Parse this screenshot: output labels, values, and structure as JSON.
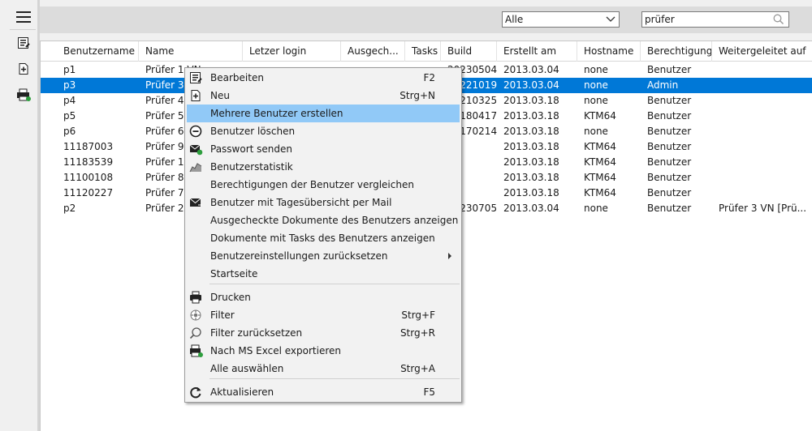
{
  "toolbar": {
    "icons": [
      "hamburger-menu-icon",
      "edit-list-icon",
      "new-document-icon",
      "export-printer-icon"
    ]
  },
  "filter": {
    "scope_value": "Alle",
    "search_value": "prüfer"
  },
  "grid": {
    "columns": [
      "Benutzername",
      "Name",
      "Letzer login",
      "Ausgech...",
      "Tasks",
      "Build",
      "Erstellt am",
      "Hostname",
      "Berechtigung",
      "Weitergeleitet auf"
    ],
    "rows": [
      {
        "user": "p1",
        "name": "Prüfer 1 VN",
        "login": "",
        "out": "",
        "tasks": "",
        "build": "20230504",
        "created": "2013.03.04",
        "host": "none",
        "perm": "Benutzer",
        "fwd": "",
        "selected": false
      },
      {
        "user": "p3",
        "name": "Prüfer 3",
        "login": "",
        "out": "",
        "tasks": "",
        "build": "20221019",
        "created": "2013.03.04",
        "host": "none",
        "perm": "Admin",
        "fwd": "",
        "selected": true
      },
      {
        "user": "p4",
        "name": "Prüfer 4",
        "login": "",
        "out": "",
        "tasks": "",
        "build": "20210325",
        "created": "2013.03.18",
        "host": "none",
        "perm": "Benutzer",
        "fwd": "",
        "selected": false
      },
      {
        "user": "p5",
        "name": "Prüfer 5",
        "login": "",
        "out": "",
        "tasks": "",
        "build": "20180417",
        "created": "2013.03.18",
        "host": "KTM64",
        "perm": "Benutzer",
        "fwd": "",
        "selected": false
      },
      {
        "user": "p6",
        "name": "Prüfer 6",
        "login": "",
        "out": "",
        "tasks": "",
        "build": "20170214",
        "created": "2013.03.18",
        "host": "none",
        "perm": "Benutzer",
        "fwd": "",
        "selected": false
      },
      {
        "user": "11187003",
        "name": "Prüfer 9",
        "login": "",
        "out": "",
        "tasks": "",
        "build": "",
        "created": "2013.03.18",
        "host": "KTM64",
        "perm": "Benutzer",
        "fwd": "",
        "selected": false
      },
      {
        "user": "11183539",
        "name": "Prüfer 10",
        "login": "",
        "out": "",
        "tasks": "",
        "build": "",
        "created": "2013.03.18",
        "host": "KTM64",
        "perm": "Benutzer",
        "fwd": "",
        "selected": false
      },
      {
        "user": "11100108",
        "name": "Prüfer 8",
        "login": "",
        "out": "",
        "tasks": "",
        "build": "",
        "created": "2013.03.18",
        "host": "KTM64",
        "perm": "Benutzer",
        "fwd": "",
        "selected": false
      },
      {
        "user": "11120227",
        "name": "Prüfer 7",
        "login": "",
        "out": "",
        "tasks": "",
        "build": "",
        "created": "2013.03.18",
        "host": "KTM64",
        "perm": "Benutzer",
        "fwd": "",
        "selected": false
      },
      {
        "user": "p2",
        "name": "Prüfer 2",
        "login": "",
        "out": "",
        "tasks": "",
        "build": "20230705",
        "created": "2013.03.04",
        "host": "none",
        "perm": "Benutzer",
        "fwd": "Prüfer 3 VN [Prü...",
        "selected": false
      }
    ]
  },
  "menu": {
    "items": [
      {
        "label": "Bearbeiten",
        "shortcut": "F2",
        "icon": "edit-icon"
      },
      {
        "label": "Neu",
        "shortcut": "Strg+N",
        "icon": "new-icon"
      },
      {
        "label": "Mehrere Benutzer erstellen",
        "shortcut": "",
        "icon": "",
        "highlighted": true
      },
      {
        "label": "Benutzer löschen",
        "shortcut": "",
        "icon": "delete-icon"
      },
      {
        "label": "Passwort senden",
        "shortcut": "",
        "icon": "send-password-icon"
      },
      {
        "label": "Benutzerstatistik",
        "shortcut": "",
        "icon": "statistics-icon"
      },
      {
        "label": "Berechtigungen der Benutzer vergleichen",
        "shortcut": "",
        "icon": ""
      },
      {
        "label": "Benutzer mit Tagesübersicht per Mail",
        "shortcut": "",
        "icon": "mail-icon"
      },
      {
        "label": "Ausgecheckte Dokumente des Benutzers anzeigen",
        "shortcut": "",
        "icon": ""
      },
      {
        "label": "Dokumente mit Tasks des Benutzers anzeigen",
        "shortcut": "",
        "icon": ""
      },
      {
        "label": "Benutzereinstellungen zurücksetzen",
        "shortcut": "",
        "icon": "",
        "submenu": true
      },
      {
        "label": "Startseite",
        "shortcut": "",
        "icon": ""
      },
      {
        "label": "Drucken",
        "shortcut": "",
        "icon": "print-icon"
      },
      {
        "label": "Filter",
        "shortcut": "Strg+F",
        "icon": "filter-icon"
      },
      {
        "label": "Filter zurücksetzen",
        "shortcut": "Strg+R",
        "icon": "reset-filter-icon"
      },
      {
        "label": "Nach MS Excel exportieren",
        "shortcut": "",
        "icon": "excel-export-icon"
      },
      {
        "label": "Alle auswählen",
        "shortcut": "Strg+A",
        "icon": ""
      },
      {
        "label": "Aktualisieren",
        "shortcut": "F5",
        "icon": "refresh-icon"
      }
    ]
  }
}
